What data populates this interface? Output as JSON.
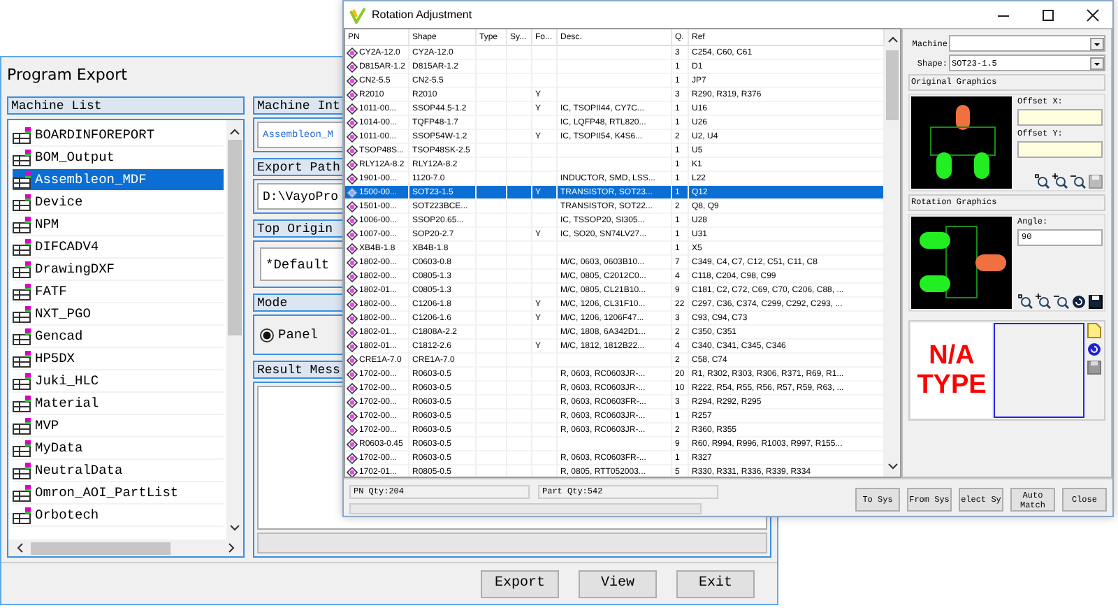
{
  "program_export": {
    "title": "Program Export",
    "machine_list": {
      "header": "Machine List",
      "items": [
        {
          "label": "BOARDINFOREPORT",
          "selected": false
        },
        {
          "label": "BOM_Output",
          "selected": false
        },
        {
          "label": "Assembleon_MDF",
          "selected": true
        },
        {
          "label": "Device",
          "selected": false
        },
        {
          "label": "NPM",
          "selected": false
        },
        {
          "label": "DIFCADV4",
          "selected": false
        },
        {
          "label": "DrawingDXF",
          "selected": false
        },
        {
          "label": "FATF",
          "selected": false
        },
        {
          "label": "NXT_PGO",
          "selected": false
        },
        {
          "label": "Gencad",
          "selected": false
        },
        {
          "label": "HP5DX",
          "selected": false
        },
        {
          "label": "Juki_HLC",
          "selected": false
        },
        {
          "label": "Material",
          "selected": false
        },
        {
          "label": "MVP",
          "selected": false
        },
        {
          "label": "MyData",
          "selected": false
        },
        {
          "label": "NeutralData",
          "selected": false
        },
        {
          "label": "Omron_AOI_PartList",
          "selected": false
        },
        {
          "label": "Orbotech",
          "selected": false
        }
      ]
    },
    "machine_interface": {
      "header": "Machine Int",
      "value": "Assembleon_M"
    },
    "export_path": {
      "header": "Export Path",
      "value": "D:\\VayoPro"
    },
    "top_origin": {
      "header": "Top Origin",
      "value": "*Default"
    },
    "mode": {
      "header": "Mode",
      "options": [
        {
          "label": "Panel",
          "selected": true
        }
      ]
    },
    "result_message": {
      "header": "Result Mess",
      "progress": {
        "level": 0
      }
    },
    "buttons": [
      "Export",
      "View",
      "Exit"
    ]
  },
  "rotation_adjustment": {
    "title": "Rotation Adjustment",
    "table": {
      "columns": [
        "PN",
        "Shape",
        "Type",
        "Sy...",
        "Fo...",
        "Desc.",
        "Q.",
        "Ref"
      ],
      "rows": [
        {
          "pn": "CY2A-12.0",
          "shape": "CY2A-12.0",
          "q": "3",
          "ref": "C254, C60, C61",
          "selected": false
        },
        {
          "pn": "D815AR-1.2",
          "shape": "D815AR-1.2",
          "q": "1",
          "ref": "D1",
          "selected": false
        },
        {
          "pn": "CN2-5.5",
          "shape": "CN2-5.5",
          "q": "1",
          "ref": "JP7",
          "selected": false
        },
        {
          "pn": "R2010",
          "shape": "R2010",
          "fo": "Y",
          "q": "3",
          "ref": "R290, R319, R376",
          "selected": false
        },
        {
          "pn": "1011-00...",
          "shape": "SSOP44.5-1.2",
          "fo": "Y",
          "desc": "IC, TSOPII44, CY7C...",
          "q": "1",
          "ref": "U16",
          "selected": false
        },
        {
          "pn": "1014-00...",
          "shape": "TQFP48-1.7",
          "desc": "IC, LQFP48, RTL820...",
          "q": "1",
          "ref": "U26",
          "selected": false
        },
        {
          "pn": "1011-00...",
          "shape": "SSOP54W-1.2",
          "fo": "Y",
          "desc": "IC, TSOPII54, K4S6...",
          "q": "2",
          "ref": "U2, U4",
          "selected": false
        },
        {
          "pn": "TSOP48S...",
          "shape": "TSOP48SK-2.5",
          "q": "1",
          "ref": "U5",
          "selected": false
        },
        {
          "pn": "RLY12A-8.2",
          "shape": "RLY12A-8.2",
          "q": "1",
          "ref": "K1",
          "selected": false
        },
        {
          "pn": "1901-00...",
          "shape": "1120-7.0",
          "desc": "INDUCTOR, SMD, LSS...",
          "q": "1",
          "ref": "L22",
          "selected": false
        },
        {
          "pn": "1500-00...",
          "shape": "SOT23-1.5",
          "fo": "Y",
          "desc": "TRANSISTOR, SOT23...",
          "q": "1",
          "ref": "Q12",
          "selected": true
        },
        {
          "pn": "1501-00...",
          "shape": "SOT223BCE...",
          "desc": "TRANSISTOR, SOT22...",
          "q": "2",
          "ref": "Q8, Q9",
          "selected": false
        },
        {
          "pn": "1006-00...",
          "shape": "SSOP20.65...",
          "desc": "IC, TSSOP20, SI305...",
          "q": "1",
          "ref": "U28",
          "selected": false
        },
        {
          "pn": "1007-00...",
          "shape": "SOP20-2.7",
          "fo": "Y",
          "desc": "IC, SO20, SN74LV27...",
          "q": "1",
          "ref": "U31",
          "selected": false
        },
        {
          "pn": "XB4B-1.8",
          "shape": "XB4B-1.8",
          "q": "1",
          "ref": "X5",
          "selected": false
        },
        {
          "pn": "1802-00...",
          "shape": "C0603-0.8",
          "desc": "M/C, 0603, 0603B10...",
          "q": "7",
          "ref": "C349, C4, C7, C12, C51, C11, C8",
          "selected": false
        },
        {
          "pn": "1802-00...",
          "shape": "C0805-1.3",
          "desc": "M/C, 0805, C2012C0...",
          "q": "4",
          "ref": "C118, C204, C98, C99",
          "selected": false
        },
        {
          "pn": "1802-01...",
          "shape": "C0805-1.3",
          "desc": "M/C, 0805, CL21B10...",
          "q": "9",
          "ref": "C181, C2, C72, C69, C70, C206, C88, ...",
          "selected": false
        },
        {
          "pn": "1802-00...",
          "shape": "C1206-1.8",
          "fo": "Y",
          "desc": "M/C, 1206, CL31F10...",
          "q": "22",
          "ref": "C297, C36, C374, C299, C292, C293, ...",
          "selected": false
        },
        {
          "pn": "1802-00...",
          "shape": "C1206-1.6",
          "fo": "Y",
          "desc": "M/C, 1206, 1206F47...",
          "q": "3",
          "ref": "C93, C94, C73",
          "selected": false
        },
        {
          "pn": "1802-01...",
          "shape": "C1808A-2.2",
          "desc": "M/C, 1808, 6A342D1...",
          "q": "2",
          "ref": "C350, C351",
          "selected": false
        },
        {
          "pn": "1802-01...",
          "shape": "C1812-2.6",
          "fo": "Y",
          "desc": "M/C, 1812, 1812B22...",
          "q": "4",
          "ref": "C340, C341, C345, C346",
          "selected": false
        },
        {
          "pn": "CRE1A-7.0",
          "shape": "CRE1A-7.0",
          "q": "2",
          "ref": "C58, C74",
          "selected": false
        },
        {
          "pn": "1702-00...",
          "shape": "R0603-0.5",
          "desc": "R, 0603, RC0603JR-...",
          "q": "20",
          "ref": "R1, R302, R303, R306, R371, R69, R1...",
          "selected": false
        },
        {
          "pn": "1702-00...",
          "shape": "R0603-0.5",
          "desc": "R, 0603, RC0603JR-...",
          "q": "10",
          "ref": "R222, R54, R55, R56, R57, R59, R63, ...",
          "selected": false
        },
        {
          "pn": "1702-00...",
          "shape": "R0603-0.5",
          "desc": "R, 0603, RC0603FR-...",
          "q": "3",
          "ref": "R294, R292, R295",
          "selected": false
        },
        {
          "pn": "1702-00...",
          "shape": "R0603-0.5",
          "desc": "R, 0603, RC0603JR-...",
          "q": "1",
          "ref": "R257",
          "selected": false
        },
        {
          "pn": "1702-00...",
          "shape": "R0603-0.5",
          "desc": "R, 0603, RC0603JR-...",
          "q": "2",
          "ref": "R360, R355",
          "selected": false
        },
        {
          "pn": "R0603-0.45",
          "shape": "R0603-0.5",
          "q": "9",
          "ref": "R60, R994, R996, R1003, R997, R155...",
          "selected": false
        },
        {
          "pn": "1702-00...",
          "shape": "R0603-0.5",
          "desc": "R, 0603, RC0603FR-...",
          "q": "1",
          "ref": "R327",
          "selected": false
        },
        {
          "pn": "1702-01...",
          "shape": "R0805-0.5",
          "desc": "R, 0805, RTT052003...",
          "q": "5",
          "ref": "R330, R331, R336, R339, R334",
          "selected": false
        }
      ]
    },
    "status": {
      "pn_qty": "PN Qty:204",
      "part_qty": "Part Qty:542",
      "progress": {
        "level": 0
      }
    },
    "machine": {
      "label": "Machine"
    },
    "shape": {
      "label": "Shape:",
      "value": "SOT23-1.5"
    },
    "original_graphics": {
      "header": "Original Graphics",
      "offset_x_label": "Offset X:",
      "offset_y_label": "Offset Y:"
    },
    "rotation_graphics": {
      "header": "Rotation Graphics",
      "angle_label": "Angle:",
      "angle": "90"
    },
    "preview": {
      "lines": [
        "N/A",
        "TYPE"
      ]
    },
    "buttons": [
      "To Sys",
      "From Sys",
      "elect Sy",
      "Auto Match",
      "Close"
    ]
  }
}
